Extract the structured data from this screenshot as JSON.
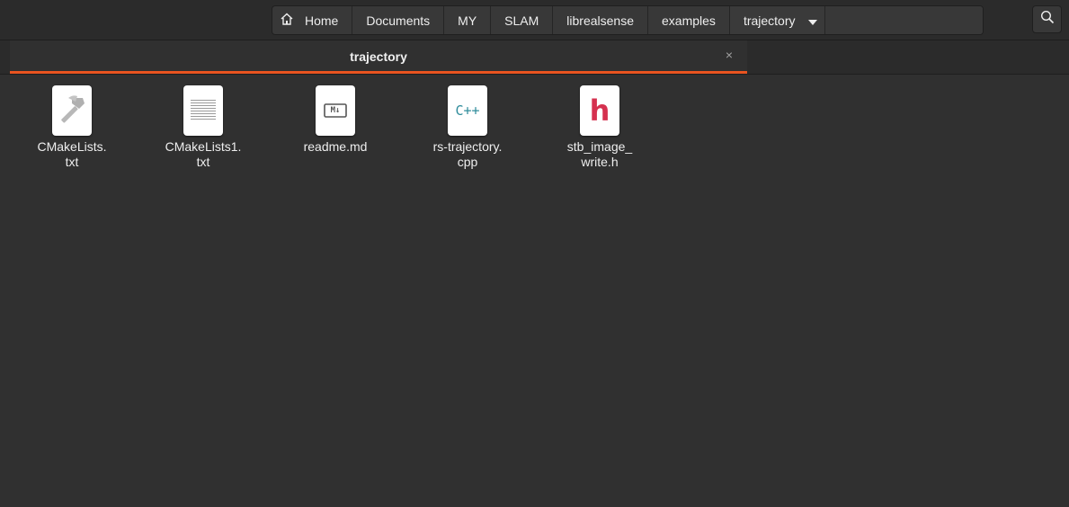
{
  "pathbar": {
    "home_label": "Home",
    "crumbs": [
      "Documents",
      "MY",
      "SLAM",
      "librealsense",
      "examples"
    ],
    "current": "trajectory"
  },
  "tab": {
    "label": "trajectory",
    "close_glyph": "×"
  },
  "files": [
    {
      "name": "CMakeLists.\ntxt",
      "icon": "build-icon"
    },
    {
      "name": "CMakeLists1.\ntxt",
      "icon": "text-file-icon"
    },
    {
      "name": "readme.md",
      "icon": "markdown-icon",
      "icon_text": "M↓"
    },
    {
      "name": "rs-trajectory.\ncpp",
      "icon": "cpp-icon",
      "icon_text": "C++"
    },
    {
      "name": "stb_image_\nwrite.h",
      "icon": "header-icon",
      "icon_text": "h"
    }
  ],
  "colors": {
    "accent": "#e95420",
    "cpp": "#2f8c9b",
    "header": "#d5314f"
  }
}
